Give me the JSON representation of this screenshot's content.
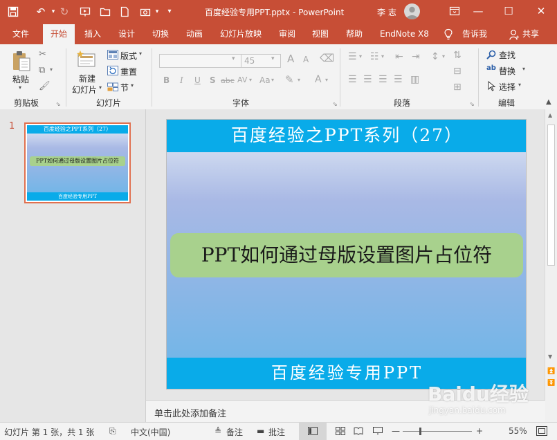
{
  "window": {
    "title": "百度经验专用PPT.pptx  -  PowerPoint",
    "user": "李 志",
    "minimize": "—",
    "restore": "▭",
    "maximize": "☐",
    "close": "✕"
  },
  "ribbon_tabs": [
    "文件",
    "开始",
    "插入",
    "设计",
    "切换",
    "动画",
    "幻灯片放映",
    "审阅",
    "视图",
    "帮助",
    "EndNote X8",
    "告诉我",
    "共享"
  ],
  "clipboard": {
    "paste": "粘贴",
    "group": "剪贴板"
  },
  "slides_group": {
    "new_slide_line1": "新建",
    "new_slide_line2": "幻灯片",
    "layout": "版式",
    "reset": "重置",
    "section": "节",
    "group": "幻灯片"
  },
  "font_group": {
    "size": "45",
    "bold": "B",
    "italic": "I",
    "underline": "U",
    "strike": "S",
    "shadow": "abc",
    "spacing": "AV",
    "case": "Aa",
    "grow": "A",
    "shrink": "A",
    "color": "A",
    "group": "字体"
  },
  "paragraph_group": {
    "group": "段落"
  },
  "editing_group": {
    "find": "查找",
    "replace": "替换",
    "select": "选择",
    "group": "编辑"
  },
  "thumbnail": {
    "number": "1",
    "title": "百度经验之PPT系列（27）",
    "body": "PPT如何通过母版设置图片占位符",
    "footer": "百度经验专用PPT"
  },
  "slide": {
    "title": "百度经验之PPT系列（27）",
    "body": "PPT如何通过母版设置图片占位符",
    "footer": "百度经验专用PPT"
  },
  "notes_placeholder": "单击此处添加备注",
  "status": {
    "slide_info": "幻灯片 第 1 张，共 1 张",
    "language": "中文(中国)",
    "notes": "备注",
    "comments": "批注",
    "zoom_minus": "—",
    "zoom_plus": "+",
    "zoom": "55%",
    "zoom_level_percent": 55
  },
  "watermark": {
    "brand": "Baidu经验",
    "url": "jingyan.baidu.com"
  }
}
